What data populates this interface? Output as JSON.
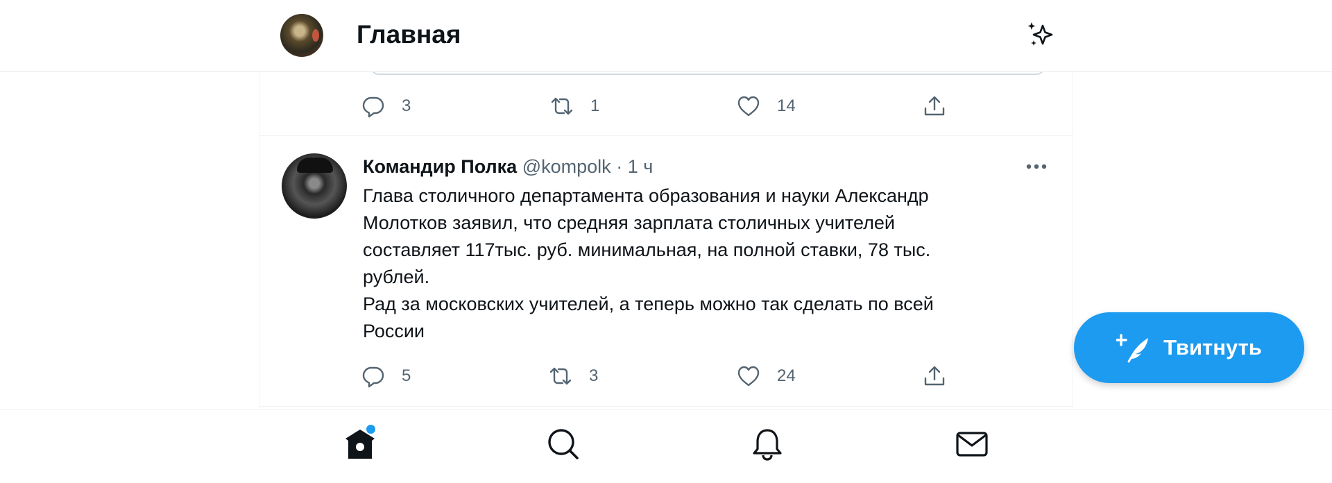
{
  "header": {
    "title": "Главная",
    "avatar": "user-avatar",
    "right_icon": "sparkle-icon"
  },
  "previous_tweet": {
    "actions": {
      "replies": "3",
      "retweets": "1",
      "likes": "14"
    }
  },
  "tweet": {
    "author_name": "Командир Полка",
    "handle": "@kompolk",
    "separator": "·",
    "time": "1 ч",
    "text": "Глава столичного департамента образования и науки Александр\nМолотков заявил, что средняя зарплата столичных учителей\nсоставляет 117тыс. руб. минимальная, на полной ставки, 78 тыс.\nрублей.\nРад за московских учителей, а теперь можно так сделать по всей\nРоссии",
    "actions": {
      "replies": "5",
      "retweets": "3",
      "likes": "24"
    }
  },
  "tweet_button": {
    "label": "Твитнуть"
  },
  "bottom_nav": {
    "items": [
      "home-icon",
      "search-icon",
      "bell-icon",
      "mail-icon"
    ],
    "home_has_new": true
  },
  "colors": {
    "accent": "#1d9bf0",
    "text_primary": "#0f1419",
    "text_secondary": "#536471",
    "border": "#eff3f4"
  }
}
